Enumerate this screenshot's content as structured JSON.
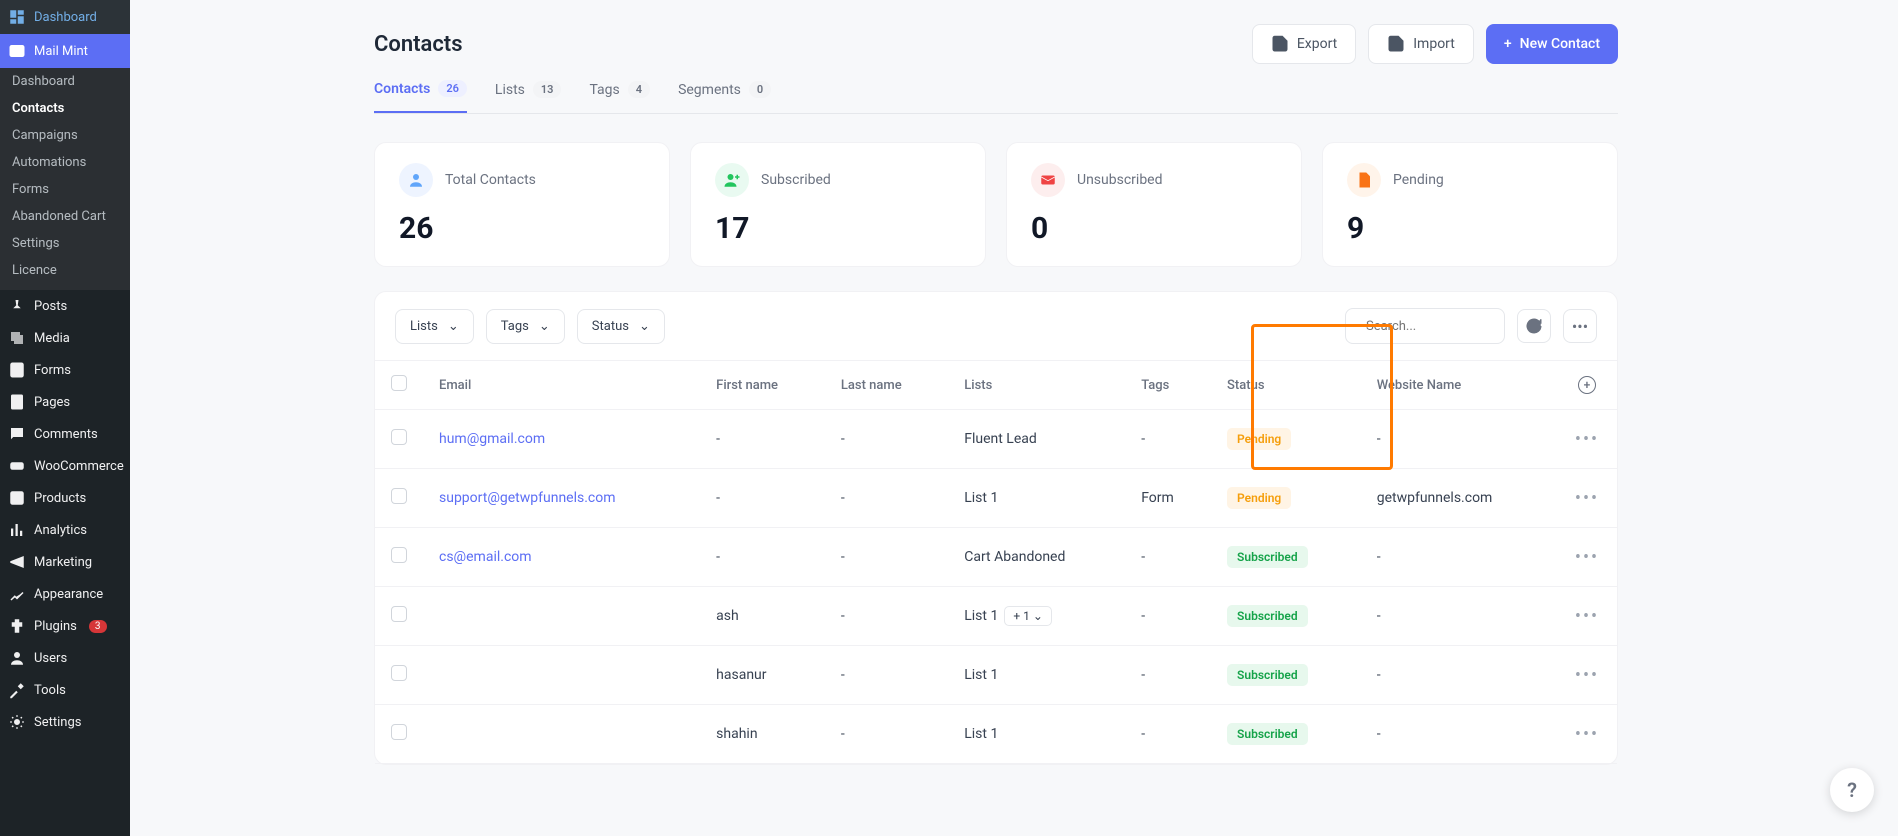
{
  "sidebar": {
    "main": [
      {
        "label": "Dashboard",
        "icon": "dashboard"
      },
      {
        "label": "Mail Mint",
        "icon": "mail"
      }
    ],
    "submenu": [
      "Dashboard",
      "Contacts",
      "Campaigns",
      "Automations",
      "Forms",
      "Abandoned Cart",
      "Settings",
      "Licence"
    ],
    "rest": [
      {
        "label": "Posts",
        "icon": "pin"
      },
      {
        "label": "Media",
        "icon": "media"
      },
      {
        "label": "Forms",
        "icon": "forms"
      },
      {
        "label": "Pages",
        "icon": "pages"
      },
      {
        "label": "Comments",
        "icon": "comments"
      },
      {
        "label": "WooCommerce",
        "icon": "woo"
      },
      {
        "label": "Products",
        "icon": "products"
      },
      {
        "label": "Analytics",
        "icon": "analytics"
      },
      {
        "label": "Marketing",
        "icon": "marketing"
      },
      {
        "label": "Appearance",
        "icon": "appearance"
      },
      {
        "label": "Plugins",
        "icon": "plugins",
        "badge": "3"
      },
      {
        "label": "Users",
        "icon": "users"
      },
      {
        "label": "Tools",
        "icon": "tools"
      },
      {
        "label": "Settings",
        "icon": "settings"
      }
    ]
  },
  "page": {
    "title": "Contacts"
  },
  "buttons": {
    "export": "Export",
    "import": "Import",
    "new_contact": "New Contact"
  },
  "tabs": [
    {
      "label": "Contacts",
      "count": "26"
    },
    {
      "label": "Lists",
      "count": "13"
    },
    {
      "label": "Tags",
      "count": "4"
    },
    {
      "label": "Segments",
      "count": "0"
    }
  ],
  "stats": [
    {
      "label": "Total Contacts",
      "value": "26",
      "bg": "#eef4ff",
      "fg": "#60a5fa",
      "icon": "users"
    },
    {
      "label": "Subscribed",
      "value": "17",
      "bg": "#e9faf1",
      "fg": "#22c55e",
      "icon": "userplus"
    },
    {
      "label": "Unsubscribed",
      "value": "0",
      "bg": "#fdeeee",
      "fg": "#ef4444",
      "icon": "mailx"
    },
    {
      "label": "Pending",
      "value": "9",
      "bg": "#fff4ea",
      "fg": "#f97316",
      "icon": "file"
    }
  ],
  "filters": {
    "lists": "Lists",
    "tags": "Tags",
    "status": "Status"
  },
  "search": {
    "placeholder": "Search..."
  },
  "columns": [
    "Email",
    "First name",
    "Last name",
    "Lists",
    "Tags",
    "Status",
    "Website Name"
  ],
  "rows": [
    {
      "email": "hum@gmail.com",
      "first": "-",
      "last": "-",
      "lists": "Fluent Lead",
      "tags": "-",
      "status": "Pending",
      "statusClass": "pending",
      "website": "-"
    },
    {
      "email": "support@getwpfunnels.com",
      "first": "-",
      "last": "-",
      "lists": "List 1",
      "tags": "Form",
      "status": "Pending",
      "statusClass": "pending",
      "website": "getwpfunnels.com"
    },
    {
      "email": "cs@email.com",
      "first": "-",
      "last": "-",
      "lists": "Cart Abandoned",
      "tags": "-",
      "status": "Subscribed",
      "statusClass": "subscribed",
      "website": "-"
    },
    {
      "email": "",
      "first": "ash",
      "last": "-",
      "lists": "List 1",
      "listsExtra": "+ 1",
      "tags": "-",
      "status": "Subscribed",
      "statusClass": "subscribed",
      "website": "-"
    },
    {
      "email": "",
      "first": "hasanur",
      "last": "-",
      "lists": "List 1",
      "tags": "-",
      "status": "Subscribed",
      "statusClass": "subscribed",
      "website": "-"
    },
    {
      "email": "",
      "first": "shahin",
      "last": "-",
      "lists": "List 1",
      "tags": "-",
      "status": "Subscribed",
      "statusClass": "subscribed",
      "website": "-"
    }
  ]
}
